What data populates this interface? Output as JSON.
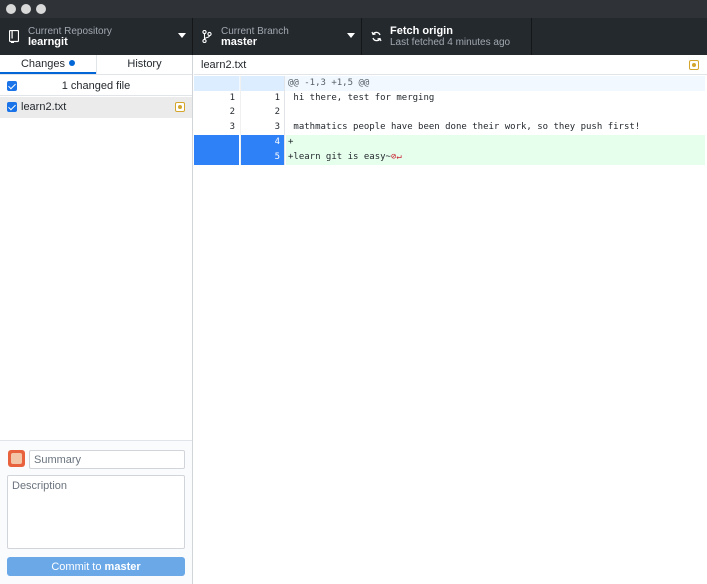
{
  "toolbar": {
    "repo": {
      "label": "Current Repository",
      "value": "learngit"
    },
    "branch": {
      "label": "Current Branch",
      "value": "master"
    },
    "fetch": {
      "label": "Fetch origin",
      "sub": "Last fetched 4 minutes ago"
    }
  },
  "sidebar": {
    "tabs": [
      {
        "label": "Changes",
        "active": true
      },
      {
        "label": "History",
        "active": false
      }
    ],
    "changed_summary": "1 changed file",
    "files": [
      {
        "name": "learn2.txt",
        "status": "modified"
      }
    ]
  },
  "commit": {
    "summary_placeholder": "Summary",
    "description_placeholder": "Description",
    "button_prefix": "Commit to ",
    "button_branch": "master"
  },
  "diff": {
    "file": "learn2.txt",
    "hunk": "@@ -1,3 +1,5 @@",
    "lines": [
      {
        "old": "1",
        "new": "1",
        "text": " hi there, test for merging",
        "type": "context"
      },
      {
        "old": "2",
        "new": "2",
        "text": "",
        "type": "context"
      },
      {
        "old": "3",
        "new": "3",
        "text": " mathmatics people have been done their work, so they push first!",
        "type": "context"
      },
      {
        "old": "",
        "new": "4",
        "text": "+",
        "type": "add"
      },
      {
        "old": "",
        "new": "5",
        "text": "+learn git is easy~",
        "type": "add",
        "no_newline_marker": "⊘↵"
      }
    ]
  },
  "colors": {
    "toolbar_bg": "#24292e",
    "accent": "#0366d6",
    "added_line_bg": "#e6ffed",
    "selected_gutter": "#2f81f7",
    "modified_badge": "#d4a72c"
  }
}
